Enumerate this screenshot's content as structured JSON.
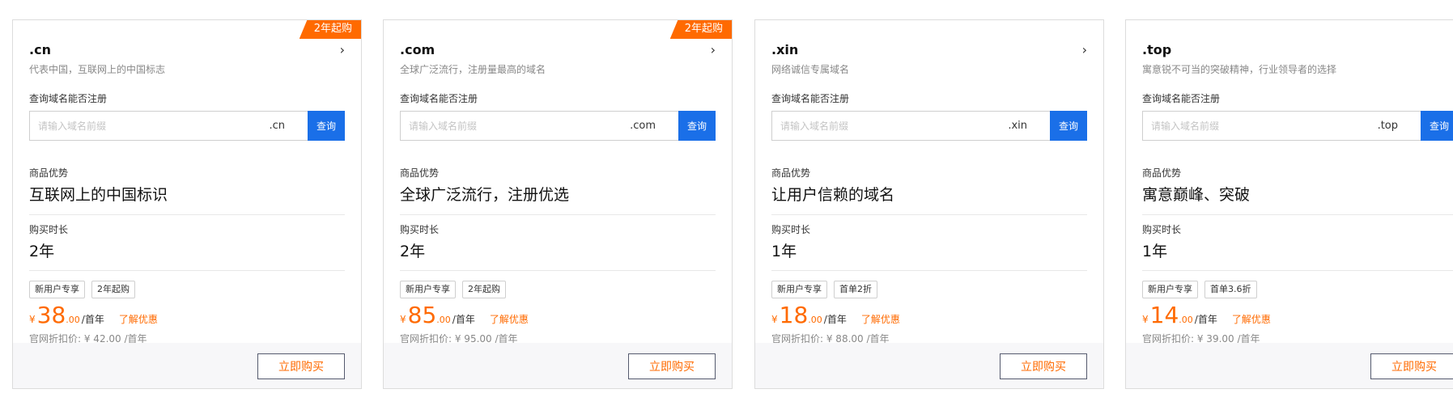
{
  "common": {
    "query_label": "查询域名能否注册",
    "search_placeholder": "请输入域名前缀",
    "search_button": "查询",
    "advantage_label": "商品优势",
    "duration_label": "购买时长",
    "promo_link": "了解优惠",
    "buy_button": "立即购买",
    "currency_symbol": "¥",
    "unit": "/首年",
    "chevron_icon": "chevron-right-icon",
    "accent_color": "#ff6a00",
    "button_color": "#1a6fe8"
  },
  "cards": [
    {
      "badge": "2年起购",
      "tld": ".cn",
      "description": "代表中国，互联网上的中国标志",
      "suffix": ".cn",
      "advantage": "互联网上的中国标识",
      "duration": "2年",
      "tags": [
        "新用户专享",
        "2年起购"
      ],
      "price_int": "38",
      "price_dec": ".00",
      "list_price": "官网折扣价: ¥ 42.00 /首年"
    },
    {
      "badge": "2年起购",
      "tld": ".com",
      "description": "全球广泛流行，注册量最高的域名",
      "suffix": ".com",
      "advantage": "全球广泛流行，注册优选",
      "duration": "2年",
      "tags": [
        "新用户专享",
        "2年起购"
      ],
      "price_int": "85",
      "price_dec": ".00",
      "list_price": "官网折扣价: ¥ 95.00 /首年"
    },
    {
      "badge": "",
      "tld": ".xin",
      "description": "网络诚信专属域名",
      "suffix": ".xin",
      "advantage": "让用户信赖的域名",
      "duration": "1年",
      "tags": [
        "新用户专享",
        "首单2折"
      ],
      "price_int": "18",
      "price_dec": ".00",
      "list_price": "官网折扣价: ¥ 88.00 /首年"
    },
    {
      "badge": "",
      "tld": ".top",
      "description": "寓意锐不可当的突破精神，行业领导者的选择",
      "suffix": ".top",
      "advantage": "寓意巅峰、突破",
      "duration": "1年",
      "tags": [
        "新用户专享",
        "首单3.6折"
      ],
      "price_int": "14",
      "price_dec": ".00",
      "list_price": "官网折扣价: ¥ 39.00 /首年"
    }
  ]
}
